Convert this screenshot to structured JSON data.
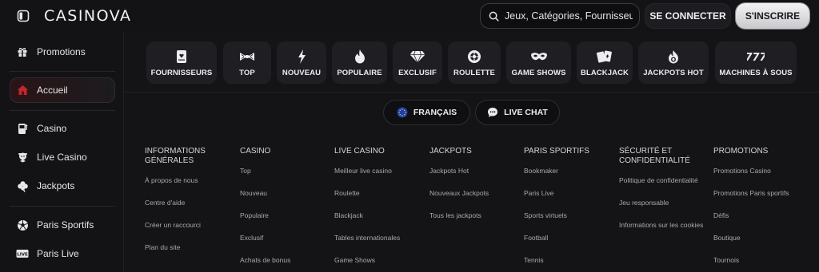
{
  "header": {
    "logo": "CASINOVA",
    "search_placeholder": "Jeux, Catégories, Fournisseurs",
    "login_label": "SE CONNECTER",
    "signup_label": "S'INSCRIRE"
  },
  "sidebar": {
    "items": [
      {
        "label": "Promotions",
        "icon": "gift-icon"
      },
      {
        "label": "Accueil",
        "icon": "home-icon",
        "active": true
      },
      {
        "label": "Casino",
        "icon": "slot-machine-icon"
      },
      {
        "label": "Live Casino",
        "icon": "dealer-icon"
      },
      {
        "label": "Jackpots",
        "icon": "clover-icon"
      },
      {
        "label": "Paris Sportifs",
        "icon": "soccer-ball-icon"
      },
      {
        "label": "Paris Live",
        "icon": "live-icon"
      }
    ]
  },
  "categories": [
    {
      "label": "FOURNISSEURS",
      "icon": "provider-icon"
    },
    {
      "label": "TOP",
      "icon": "bow-tie-icon"
    },
    {
      "label": "NOUVEAU",
      "icon": "lightning-icon"
    },
    {
      "label": "POPULAIRE",
      "icon": "flame-icon"
    },
    {
      "label": "EXCLUSIF",
      "icon": "diamond-icon"
    },
    {
      "label": "ROULETTE",
      "icon": "roulette-icon"
    },
    {
      "label": "GAME SHOWS",
      "icon": "mask-icon"
    },
    {
      "label": "BLACKJACK",
      "icon": "cards-icon"
    },
    {
      "label": "JACKPOTS HOT",
      "icon": "hot-jackpot-icon"
    },
    {
      "label": "MACHINES À SOUS",
      "icon": "777-icon"
    }
  ],
  "pills": {
    "language": "FRANÇAIS",
    "live_chat": "LIVE CHAT"
  },
  "footer": {
    "columns": [
      {
        "title": "INFORMATIONS GÉNÉRALES",
        "links": [
          "À propos de nous",
          "Centre d'aide",
          "Créer un raccourci",
          "Plan du site"
        ]
      },
      {
        "title": "CASINO",
        "links": [
          "Top",
          "Nouveau",
          "Populaire",
          "Exclusif",
          "Achats de bonus"
        ]
      },
      {
        "title": "LIVE CASINO",
        "links": [
          "Meilleur live casino",
          "Roulette",
          "Blackjack",
          "Tables internationales",
          "Game Shows"
        ]
      },
      {
        "title": "JACKPOTS",
        "links": [
          "Jackpots Hot",
          "Nouveaux Jackpots",
          "Tous les jackpots"
        ]
      },
      {
        "title": "PARIS SPORTIFS",
        "links": [
          "Bookmaker",
          "Paris Live",
          "Sports virtuels",
          "Football",
          "Tennis"
        ]
      },
      {
        "title": "SÉCURITÉ ET CONFIDENTIALITÉ",
        "links": [
          "Politique de confidentialité",
          "Jeu responsable",
          "Informations sur les cookies"
        ]
      },
      {
        "title": "PROMOTIONS",
        "links": [
          "Promotions Casino",
          "Promotions Paris sportifs",
          "Défis",
          "Boutique",
          "Tournois"
        ]
      }
    ]
  },
  "colors": {
    "background": "#131315",
    "card": "#1f1f23",
    "accent_red": "#c0282e",
    "text": "#ececee",
    "muted_text": "#a9a9ae"
  }
}
